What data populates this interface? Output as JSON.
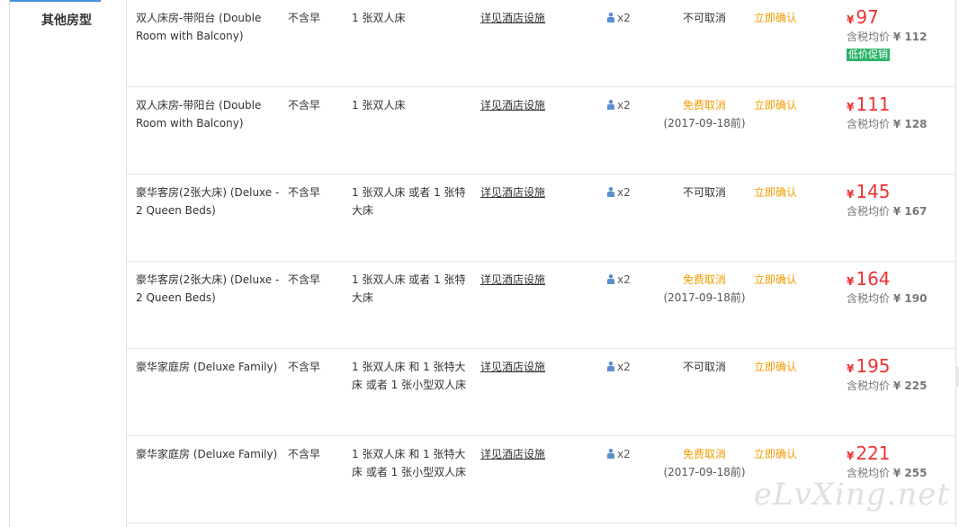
{
  "category": "其他房型",
  "facility_link": "详见酒店设施",
  "tax_prefix": "含税均价",
  "currency": "¥",
  "rows": [
    {
      "name": "双人床房-带阳台 (Double Room with Balcony)",
      "breakfast": "不含早",
      "bed": "1 张双人床",
      "occupancy": "x2",
      "cancel": "不可取消",
      "cancel_date": "",
      "confirm": "立即确认",
      "price": "97",
      "tax_price": "¥ 112",
      "badge": "低价促销"
    },
    {
      "name": "双人床房-带阳台 (Double Room with Balcony)",
      "breakfast": "不含早",
      "bed": "1 张双人床",
      "occupancy": "x2",
      "cancel": "免费取消",
      "cancel_date": "(2017-09-18前)",
      "confirm": "立即确认",
      "price": "111",
      "tax_price": "¥ 128",
      "badge": ""
    },
    {
      "name": "豪华客房(2张大床) (Deluxe - 2 Queen Beds)",
      "breakfast": "不含早",
      "bed": "1 张双人床 或者 1 张特大床",
      "occupancy": "x2",
      "cancel": "不可取消",
      "cancel_date": "",
      "confirm": "立即确认",
      "price": "145",
      "tax_price": "¥ 167",
      "badge": ""
    },
    {
      "name": "豪华客房(2张大床) (Deluxe - 2 Queen Beds)",
      "breakfast": "不含早",
      "bed": "1 张双人床 或者 1 张特大床",
      "occupancy": "x2",
      "cancel": "免费取消",
      "cancel_date": "(2017-09-18前)",
      "confirm": "立即确认",
      "price": "164",
      "tax_price": "¥ 190",
      "badge": ""
    },
    {
      "name": "豪华家庭房 (Deluxe Family)",
      "breakfast": "不含早",
      "bed": "1 张双人床 和 1 张特大床 或者 1 张小型双人床",
      "occupancy": "x2",
      "cancel": "不可取消",
      "cancel_date": "",
      "confirm": "立即确认",
      "price": "195",
      "tax_price": "¥ 225",
      "badge": ""
    },
    {
      "name": "豪华家庭房 (Deluxe Family)",
      "breakfast": "不含早",
      "bed": "1 张双人床 和 1 张特大床 或者 1 张小型双人床",
      "occupancy": "x2",
      "cancel": "免费取消",
      "cancel_date": "(2017-09-18前)",
      "confirm": "立即确认",
      "price": "221",
      "tax_price": "¥ 255",
      "badge": ""
    }
  ],
  "colors": {
    "price": "#ee3333",
    "free_cancel": "#f29c00",
    "confirm": "#f29c00",
    "promo_badge": "#2db36a",
    "person_icon": "#5b8fd0"
  },
  "icons": {
    "occupancy": "person-icon"
  },
  "watermark": "eLvXing.net"
}
